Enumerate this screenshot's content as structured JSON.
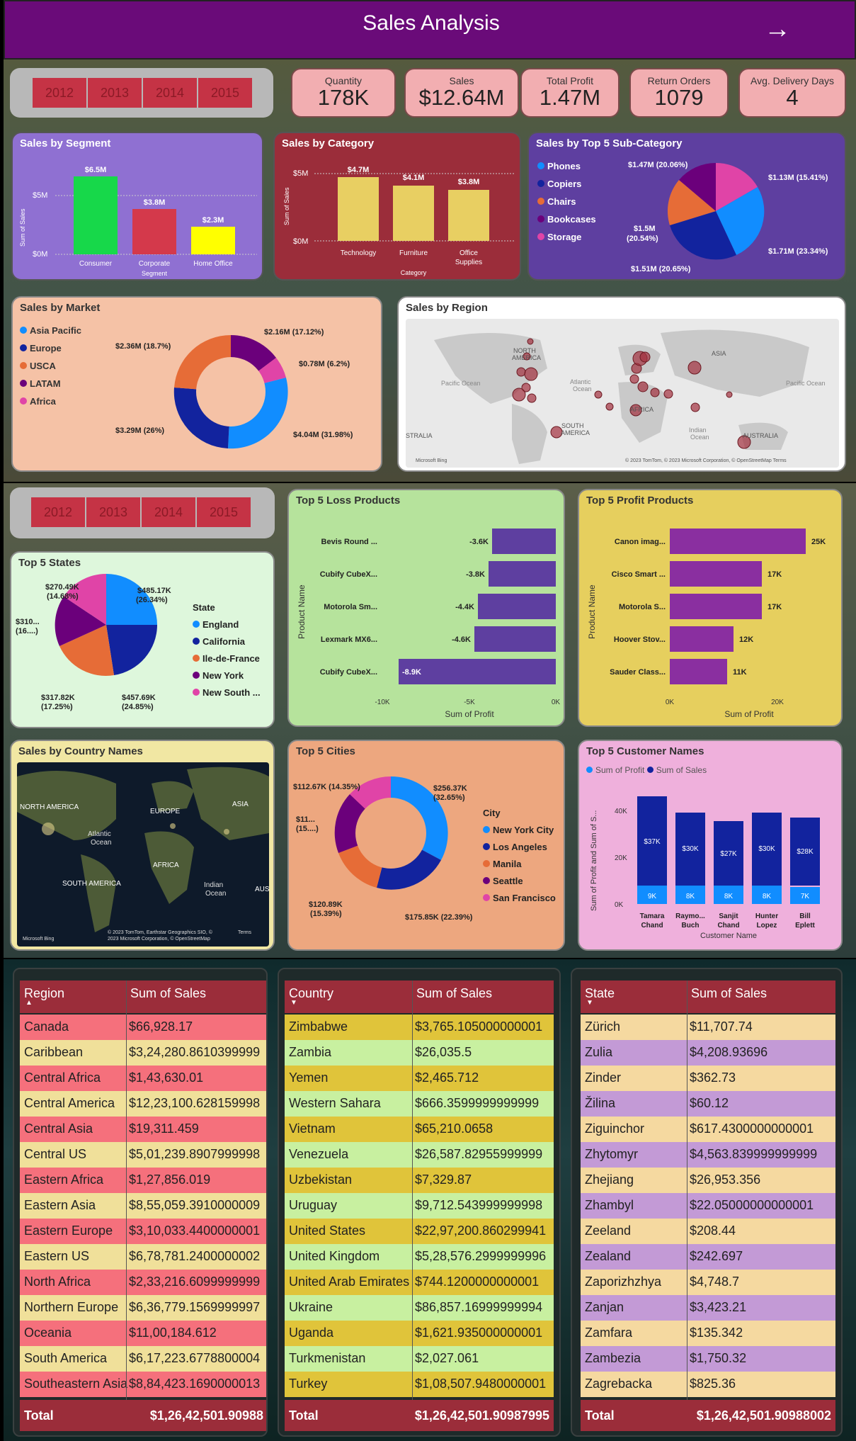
{
  "header": {
    "title": "Sales Analysis"
  },
  "years": [
    "2012",
    "2013",
    "2014",
    "2015"
  ],
  "kpis": [
    {
      "label": "Quantity",
      "value": "178K"
    },
    {
      "label": "Sales",
      "value": "$12.64M"
    },
    {
      "label": "Total Profit",
      "value": "1.47M"
    },
    {
      "label": "Return Orders",
      "value": "1079"
    },
    {
      "label": "Avg. Delivery Days",
      "value": "4"
    }
  ],
  "segment": {
    "title": "Sales by Segment",
    "ylabel": "Sum of Sales",
    "xlabel": "Segment",
    "ticks": [
      "$5M",
      "$0M"
    ],
    "bars": [
      {
        "label": "Consumer",
        "value": "$6.5M",
        "color": "#17d84a"
      },
      {
        "label": "Corporate",
        "value": "$3.8M",
        "color": "#d4394b"
      },
      {
        "label": "Home Office",
        "value": "$2.3M",
        "color": "#ffff00"
      }
    ]
  },
  "category": {
    "title": "Sales by Category",
    "ylabel": "Sum of Sales",
    "xlabel": "Category",
    "ticks": [
      "$5M",
      "$0M"
    ],
    "bars": [
      {
        "label": "Technology",
        "value": "$4.7M"
      },
      {
        "label": "Furniture",
        "value": "$4.1M"
      },
      {
        "label": "Office",
        "label2": "Supplies",
        "value": "$3.8M"
      }
    ]
  },
  "subcat": {
    "title": "Sales by Top 5 Sub-Category",
    "legend": [
      {
        "name": "Phones",
        "color": "#118dff"
      },
      {
        "name": "Copiers",
        "color": "#12239e"
      },
      {
        "name": "Chairs",
        "color": "#e66c37"
      },
      {
        "name": "Bookcases",
        "color": "#6b007b"
      },
      {
        "name": "Storage",
        "color": "#e044a7"
      }
    ],
    "labels": [
      "$1.47M (20.06%)",
      "$1.13M (15.41%)",
      "$1.71M (23.34%)",
      "$1.51M (20.65%)",
      "$1.5M",
      "(20.54%)"
    ]
  },
  "market": {
    "title": "Sales by Market",
    "legend": [
      {
        "name": "Asia Pacific",
        "color": "#118dff"
      },
      {
        "name": "Europe",
        "color": "#12239e"
      },
      {
        "name": "USCA",
        "color": "#e66c37"
      },
      {
        "name": "LATAM",
        "color": "#6b007b"
      },
      {
        "name": "Africa",
        "color": "#e044a7"
      }
    ],
    "labels": [
      "$2.16M (17.12%)",
      "$0.78M (6.2%)",
      "$4.04M (31.98%)",
      "$3.29M (26%)",
      "$2.36M (18.7%)"
    ]
  },
  "region": {
    "title": "Sales by Region",
    "labels": [
      "NORTH",
      "AMERICA",
      "ASIA",
      "Pacific Ocean",
      "Atlantic",
      "Ocean",
      "Pacific Ocean",
      "AFRICA",
      "SOUTH",
      "AMERICA",
      "Indian",
      "Ocean",
      "STRALIA",
      "AUSTRALIA"
    ],
    "credit": "© 2023 TomTom, © 2023 Microsoft Corporation, © OpenStreetMap  Terms",
    "bing": "Microsoft Bing"
  },
  "states": {
    "title": "Top 5 States",
    "legend_title": "State",
    "legend": [
      {
        "name": "England",
        "color": "#118dff"
      },
      {
        "name": "California",
        "color": "#12239e"
      },
      {
        "name": "Ile-de-France",
        "color": "#e66c37"
      },
      {
        "name": "New York",
        "color": "#6b007b"
      },
      {
        "name": "New South ...",
        "color": "#e044a7"
      }
    ],
    "labels": [
      "$485.17K",
      "(26.34%)",
      "$457.69K",
      "(24.85%)",
      "$317.82K",
      "(17.25%)",
      "$310...",
      "(16....)",
      "$270.49K",
      "(14.68%)"
    ]
  },
  "loss": {
    "title": "Top 5 Loss Products",
    "ylabel": "Product Name",
    "xlabel": "Sum of Profit",
    "ticks": [
      "-10K",
      "-5K",
      "0K"
    ],
    "rows": [
      {
        "name": "Bevis Round ...",
        "value": "-3.6K"
      },
      {
        "name": "Cubify CubeX...",
        "value": "-3.8K"
      },
      {
        "name": "Motorola Sm...",
        "value": "-4.4K"
      },
      {
        "name": "Lexmark MX6...",
        "value": "-4.6K"
      },
      {
        "name": "Cubify CubeX...",
        "value": "-8.9K"
      }
    ]
  },
  "profit": {
    "title": "Top 5 Profit Products",
    "ylabel": "Product Name",
    "xlabel": "Sum of Profit",
    "ticks": [
      "0K",
      "20K"
    ],
    "rows": [
      {
        "name": "Canon imag...",
        "value": "25K"
      },
      {
        "name": "Cisco Smart ...",
        "value": "17K"
      },
      {
        "name": "Motorola S...",
        "value": "17K"
      },
      {
        "name": "Hoover Stov...",
        "value": "12K"
      },
      {
        "name": "Sauder Class...",
        "value": "11K"
      }
    ]
  },
  "country_map": {
    "title": "Sales by Country Names",
    "labels": [
      "NORTH AMERICA",
      "EUROPE",
      "ASIA",
      "Atlantic",
      "Ocean",
      "AFRICA",
      "SOUTH AMERICA",
      "Indian",
      "Ocean",
      "AUS"
    ],
    "credit": "© 2023 TomTom, Earthstar Geographics SIO, ©",
    "credit2": "2023 Microsoft Corporation, © OpenStreetMap",
    "terms": "Terms",
    "bing": "Microsoft Bing"
  },
  "cities": {
    "title": "Top 5 Cities",
    "legend_title": "City",
    "legend": [
      {
        "name": "New York City",
        "color": "#118dff"
      },
      {
        "name": "Los Angeles",
        "color": "#12239e"
      },
      {
        "name": "Manila",
        "color": "#e66c37"
      },
      {
        "name": "Seattle",
        "color": "#6b007b"
      },
      {
        "name": "San Francisco",
        "color": "#e044a7"
      }
    ],
    "labels": [
      "$256.37K",
      "(32.65%)",
      "$175.85K (22.39%)",
      "$120.89K",
      "(15.39%)",
      "$11...",
      "(15....)",
      "$112.67K (14.35%)"
    ]
  },
  "customers": {
    "title": "Top 5 Customer Names",
    "legend": [
      {
        "name": "Sum of Profit",
        "color": "#118dff"
      },
      {
        "name": "Sum of Sales",
        "color": "#12239e"
      }
    ],
    "ylabel": "Sum of Profit and Sum of S...",
    "xlabel": "Customer Name",
    "ticks": [
      "40K",
      "20K",
      "0K"
    ],
    "bars": [
      {
        "n1": "Tamara",
        "n2": "Chand",
        "sales": "$37K",
        "profit": "9K"
      },
      {
        "n1": "Raymo...",
        "n2": "Buch",
        "sales": "$30K",
        "profit": "8K"
      },
      {
        "n1": "Sanjit",
        "n2": "Chand",
        "sales": "$27K",
        "profit": "8K"
      },
      {
        "n1": "Hunter",
        "n2": "Lopez",
        "sales": "$30K",
        "profit": "8K"
      },
      {
        "n1": "Bill",
        "n2": "Eplett",
        "sales": "$28K",
        "profit": "7K"
      }
    ]
  },
  "table_region": {
    "h1": "Region",
    "h2": "Sum of Sales",
    "rows": [
      [
        "Canada",
        "$66,928.17"
      ],
      [
        "Caribbean",
        "$3,24,280.8610399999"
      ],
      [
        "Central Africa",
        "$1,43,630.01"
      ],
      [
        "Central America",
        "$12,23,100.628159998"
      ],
      [
        "Central Asia",
        "$19,311.459"
      ],
      [
        "Central US",
        "$5,01,239.8907999998"
      ],
      [
        "Eastern Africa",
        "$1,27,856.019"
      ],
      [
        "Eastern Asia",
        "$8,55,059.3910000009"
      ],
      [
        "Eastern Europe",
        "$3,10,033.4400000001"
      ],
      [
        "Eastern US",
        "$6,78,781.2400000002"
      ],
      [
        "North Africa",
        "$2,33,216.6099999999"
      ],
      [
        "Northern Europe",
        "$6,36,779.1569999997"
      ],
      [
        "Oceania",
        "$11,00,184.612"
      ],
      [
        "South America",
        "$6,17,223.6778800004"
      ],
      [
        "Southeastern Asia",
        "$8,84,423.1690000013"
      ]
    ],
    "total_label": "Total",
    "total": "$1,26,42,501.90988"
  },
  "table_country": {
    "h1": "Country",
    "h2": "Sum of Sales",
    "rows": [
      [
        "Zimbabwe",
        "$3,765.105000000001"
      ],
      [
        "Zambia",
        "$26,035.5"
      ],
      [
        "Yemen",
        "$2,465.712"
      ],
      [
        "Western Sahara",
        "$666.3599999999999"
      ],
      [
        "Vietnam",
        "$65,210.0658"
      ],
      [
        "Venezuela",
        "$26,587.82955999999"
      ],
      [
        "Uzbekistan",
        "$7,329.87"
      ],
      [
        "Uruguay",
        "$9,712.543999999998"
      ],
      [
        "United States",
        "$22,97,200.860299941"
      ],
      [
        "United Kingdom",
        "$5,28,576.2999999996"
      ],
      [
        "United Arab Emirates",
        "$744.1200000000001"
      ],
      [
        "Ukraine",
        "$86,857.16999999994"
      ],
      [
        "Uganda",
        "$1,621.935000000001"
      ],
      [
        "Turkmenistan",
        "$2,027.061"
      ],
      [
        "Turkey",
        "$1,08,507.9480000001"
      ]
    ],
    "total_label": "Total",
    "total": "$1,26,42,501.90987995"
  },
  "table_state": {
    "h1": "State",
    "h2": "Sum of Sales",
    "rows": [
      [
        "Zürich",
        "$11,707.74"
      ],
      [
        "Zulia",
        "$4,208.93696"
      ],
      [
        "Zinder",
        "$362.73"
      ],
      [
        "Žilina",
        "$60.12"
      ],
      [
        "Ziguinchor",
        "$617.4300000000001"
      ],
      [
        "Zhytomyr",
        "$4,563.839999999999"
      ],
      [
        "Zhejiang",
        "$26,953.356"
      ],
      [
        "Zhambyl",
        "$22.05000000000001"
      ],
      [
        "Zeeland",
        "$208.44"
      ],
      [
        "Zealand",
        "$242.697"
      ],
      [
        "Zaporizhzhya",
        "$4,748.7"
      ],
      [
        "Zanjan",
        "$3,423.21"
      ],
      [
        "Zamfara",
        "$135.342"
      ],
      [
        "Zambezia",
        "$1,750.32"
      ],
      [
        "Zagrebacka",
        "$825.36"
      ]
    ],
    "total_label": "Total",
    "total": "$1,26,42,501.90988002"
  }
}
